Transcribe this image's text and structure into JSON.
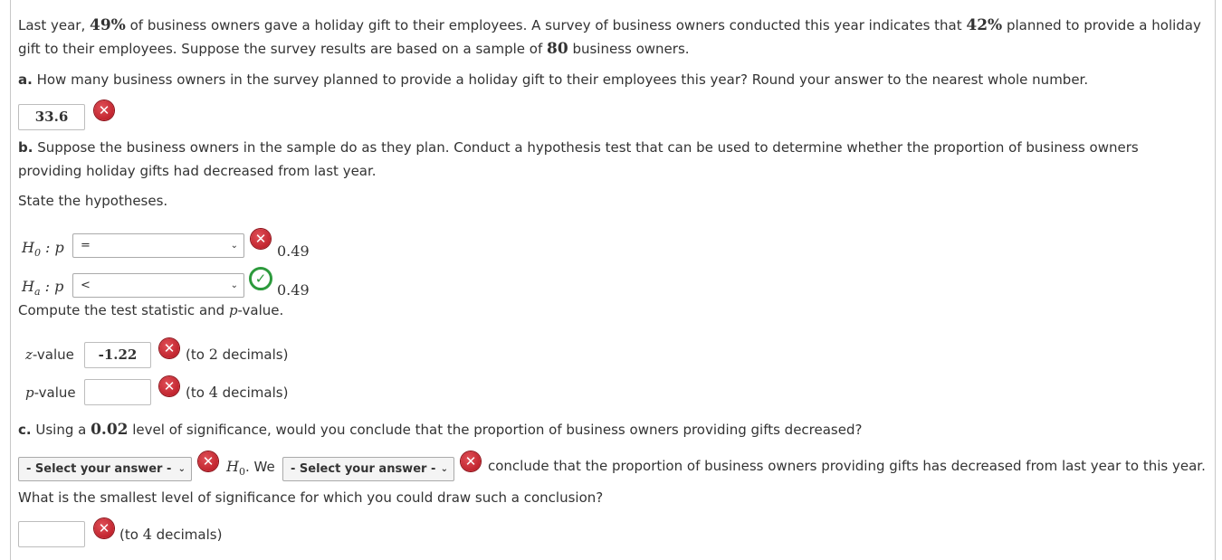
{
  "intro": {
    "t1": "Last year, ",
    "pct_last": "49%",
    "t2": " of business owners gave a holiday gift to their employees. A survey of business owners conducted this year indicates that ",
    "pct_this": "42%",
    "t3": " planned to provide a holiday",
    "t4": "gift to their employees. Suppose the survey results are based on a sample of ",
    "n": "80",
    "t5": " business owners."
  },
  "part_a": {
    "label": "a.",
    "question": " How many business owners in the survey planned to provide a holiday gift to their employees this year? Round your answer to the nearest whole number.",
    "answer_value": "33.6"
  },
  "part_b": {
    "label": "b.",
    "text1": " Suppose the business owners in the sample do as they plan. Conduct a hypothesis test that can be used to determine whether the proportion of business owners",
    "text2": "providing holiday gifts had decreased from last year.",
    "state": "State the hypotheses.",
    "h0_label": "H",
    "h0_sub": "0",
    "h0_suffix": " : p",
    "h0_operator": "=",
    "h0_value": "0.49",
    "ha_label": "H",
    "ha_sub": "a",
    "ha_suffix": " : p",
    "ha_operator": "<",
    "ha_value": "0.49",
    "compute": "Compute the test statistic and ",
    "compute_p": "p",
    "compute_end": "-value.",
    "z_label_italic": "z",
    "z_label_rest": "-value",
    "z_value": "-1.22",
    "z_hint_pre": "(to ",
    "z_hint_num": "2",
    "z_hint_post": " decimals)",
    "p_label_italic": "p",
    "p_label_rest": "-value",
    "p_value": "",
    "p_hint_pre": "(to ",
    "p_hint_num": "4",
    "p_hint_post": " decimals)"
  },
  "part_c": {
    "label": "c.",
    "q_pre": " Using a ",
    "alpha": "0.02",
    "q_post": " level of significance, would you conclude that the proportion of business owners providing gifts decreased?",
    "select1": "- Select your answer -",
    "h0_text": "H",
    "h0_sub": "0",
    "we": ". We",
    "select2": "- Select your answer -",
    "conclusion": "conclude that the proportion of business owners providing gifts has decreased from last year to this year.",
    "smallest": "What is the smallest level of significance for which you could draw such a conclusion?",
    "answer_value": "",
    "hint_pre": "(to ",
    "hint_num": "4",
    "hint_post": " decimals)"
  },
  "icons": {
    "wrong": "✕",
    "correct": "✓",
    "chevron": "⌄"
  },
  "colors": {
    "wrong_red": "#c8182a",
    "correct_green": "#2c9a3c"
  }
}
